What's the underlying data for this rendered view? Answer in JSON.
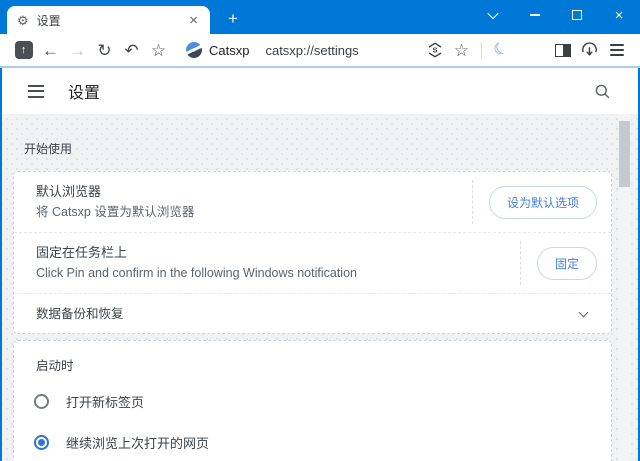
{
  "window": {
    "app_title": "设置",
    "controls": {
      "close_glyph": "×"
    }
  },
  "tabbar": {
    "tab": {
      "label": "设置",
      "close_glyph": "×"
    },
    "new_tab_glyph": "+"
  },
  "toolbar": {
    "brand": "Catsxp",
    "url": "catsxp://settings",
    "icons": {
      "boss_arrow": "↑",
      "back": "←",
      "forward": "→",
      "refresh": "↻",
      "undo": "↶",
      "home_star": "☆",
      "extension_s": "S",
      "bookmark_star": "☆",
      "dark_mode_moon": "☾"
    }
  },
  "settings_header": {
    "title": "设置"
  },
  "page": {
    "section_label": "开始使用",
    "card1": {
      "rows": [
        {
          "title": "默认浏览器",
          "subtitle": "将 Catsxp 设置为默认浏览器",
          "button": "设为默认选项"
        },
        {
          "title": "固定在任务栏上",
          "subtitle": "Click Pin and confirm in the following Windows notification",
          "button": "固定"
        },
        {
          "title": "数据备份和恢复"
        }
      ]
    },
    "card2": {
      "label": "启动时",
      "options": [
        {
          "label": "打开新标签页",
          "selected": false
        },
        {
          "label": "继续浏览上次打开的网页",
          "selected": true
        }
      ]
    }
  },
  "colors": {
    "accent_blue": "#0078d7",
    "link_blue": "#4a80d8",
    "radio_selected": "#2b74d9",
    "page_bg": "#f0f2f4"
  }
}
